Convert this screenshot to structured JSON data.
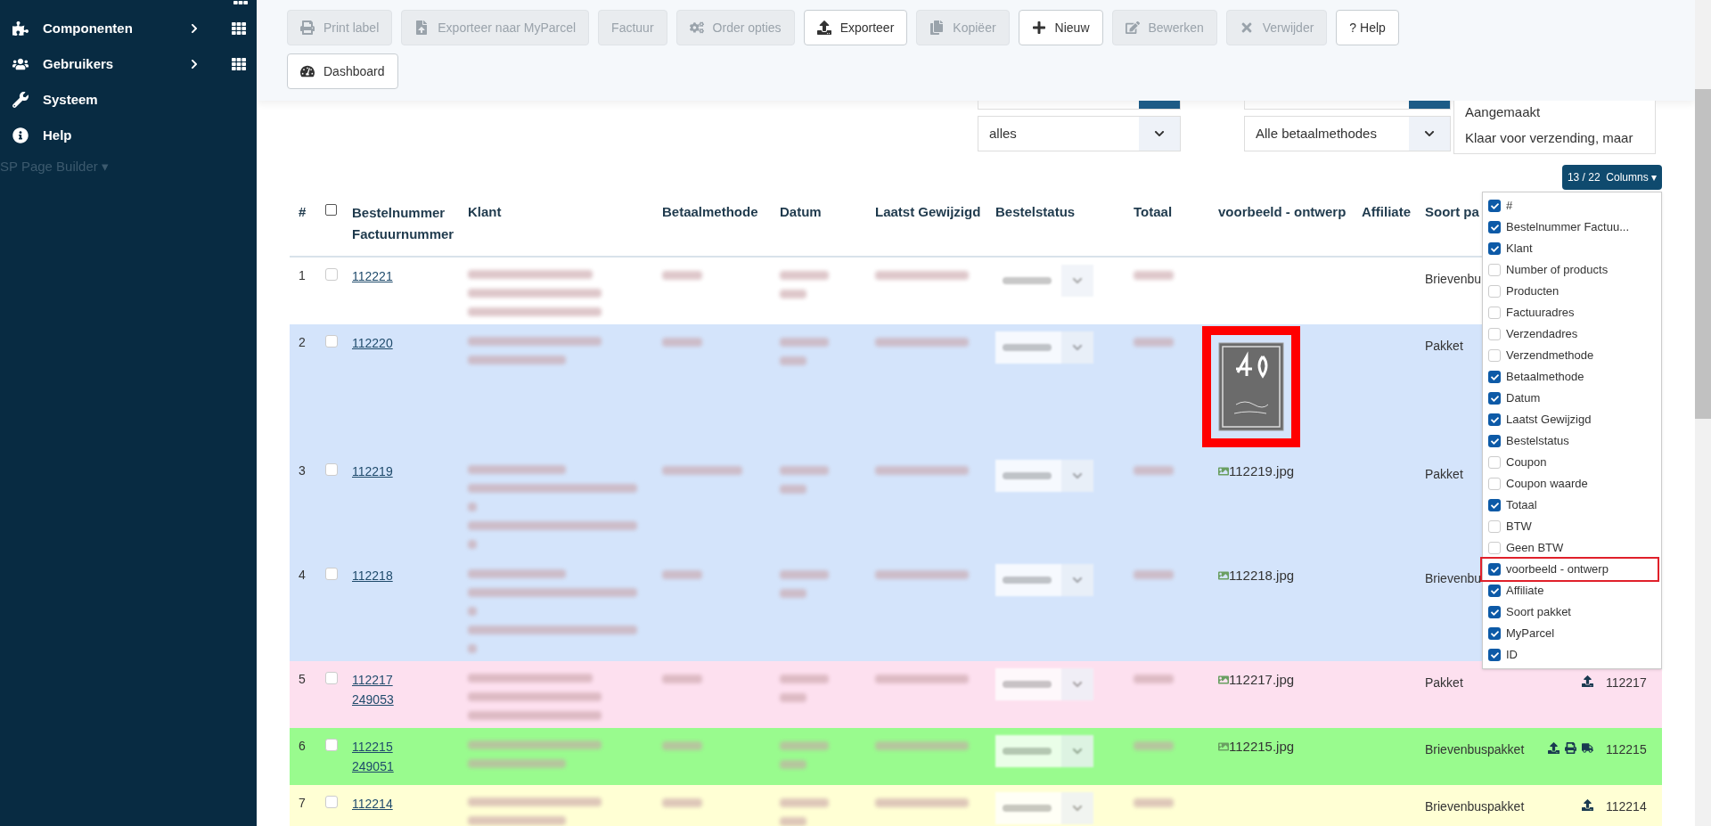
{
  "sidebar": {
    "items": [
      {
        "label": "Componenten",
        "has_submenu": true
      },
      {
        "label": "Gebruikers",
        "has_submenu": true
      },
      {
        "label": "Systeem",
        "has_submenu": false
      },
      {
        "label": "Help",
        "has_submenu": false
      }
    ],
    "faded_item": "SP Page Builder ▾"
  },
  "toolbar": {
    "rows": [
      [
        {
          "label": "Print label",
          "disabled": true
        },
        {
          "label": "Exporteer naar MyParcel",
          "disabled": true
        },
        {
          "label": "Factuur",
          "disabled": true
        },
        {
          "label": "Order opties",
          "disabled": true
        },
        {
          "label": "Exporteer",
          "disabled": false
        },
        {
          "label": "Kopiëer",
          "disabled": true
        },
        {
          "label": "Nieuw",
          "disabled": false
        },
        {
          "label": "Bewerken",
          "disabled": true
        },
        {
          "label": "Verwijder",
          "disabled": true
        },
        {
          "label": "? Help",
          "disabled": false
        }
      ],
      [
        {
          "label": "Dashboard",
          "disabled": false
        }
      ]
    ]
  },
  "filters": {
    "select_1": "alles",
    "select_2": "Alle betaalmethodes",
    "status_options": [
      "Aangemaakt",
      "Klaar voor verzending, maar"
    ]
  },
  "columns_button": "13 / 22  Columns ▾",
  "table": {
    "select_all_checked": false,
    "columns": [
      "#",
      "Bestelnummer",
      "Factuurnummer",
      "Klant",
      "Betaalmethode",
      "Datum",
      "Laatst Gewijzigd",
      "Bestelstatus",
      "Totaal",
      "voorbeeld - ontwerp",
      "Affiliate",
      "Soort pa"
    ],
    "rows": [
      {
        "num": "1",
        "checked": false,
        "order": "112221",
        "color": "#ffffff",
        "kind": "medium",
        "preview": {
          "kind": "none"
        },
        "package": "Brievenbu",
        "actions": []
      },
      {
        "num": "2",
        "checked": false,
        "order": "112220",
        "color": "#d4e4fb",
        "kind": "short",
        "preview": {
          "kind": "plaque"
        },
        "package": "Pakket",
        "actions": []
      },
      {
        "num": "3",
        "checked": false,
        "order": "112219",
        "color": "#d4e4fb",
        "kind": "long",
        "preview": {
          "kind": "broken",
          "alt": "112219.jpg"
        },
        "package": "Pakket",
        "actions": []
      },
      {
        "num": "4",
        "checked": false,
        "order": "112218",
        "color": "#d4e4fb",
        "kind": "long",
        "preview": {
          "kind": "broken",
          "alt": "112218.jpg"
        },
        "package": "Brievenbu",
        "actions": []
      },
      {
        "num": "5",
        "checked": false,
        "order": "112217",
        "invoice": "249053",
        "color": "#fde0ef",
        "kind": "medium",
        "preview": {
          "kind": "broken",
          "alt": "112217.jpg"
        },
        "package": "Pakket",
        "actions": [
          {
            "kind": "export"
          }
        ],
        "id": "112217"
      },
      {
        "num": "6",
        "checked": false,
        "order": "112215",
        "invoice": "249051",
        "color": "#99fb8e",
        "kind": "short",
        "preview": {
          "kind": "broken",
          "alt": "112215.jpg"
        },
        "package": "Brievenbuspakket",
        "actions": [
          {
            "kind": "export"
          },
          {
            "kind": "print"
          },
          {
            "kind": "truck"
          }
        ],
        "id": "112215"
      },
      {
        "num": "7",
        "checked": false,
        "order": "112214",
        "color": "#ffffd4",
        "kind": "short",
        "preview": {
          "kind": "none"
        },
        "package": "Brievenbuspakket",
        "actions": [
          {
            "kind": "export"
          }
        ],
        "id": "112214"
      }
    ]
  },
  "column_menu": [
    {
      "label": "#",
      "checked": true,
      "highlighted": false
    },
    {
      "label": "Bestelnummer Factuu...",
      "checked": true,
      "highlighted": false
    },
    {
      "label": "Klant",
      "checked": true,
      "highlighted": false
    },
    {
      "label": "Number of products",
      "checked": false,
      "highlighted": false
    },
    {
      "label": "Producten",
      "checked": false,
      "highlighted": false
    },
    {
      "label": "Factuuradres",
      "checked": false,
      "highlighted": false
    },
    {
      "label": "Verzendadres",
      "checked": false,
      "highlighted": false
    },
    {
      "label": "Verzendmethode",
      "checked": false,
      "highlighted": false
    },
    {
      "label": "Betaalmethode",
      "checked": true,
      "highlighted": false
    },
    {
      "label": "Datum",
      "checked": true,
      "highlighted": false
    },
    {
      "label": "Laatst Gewijzigd",
      "checked": true,
      "highlighted": false
    },
    {
      "label": "Bestelstatus",
      "checked": true,
      "highlighted": false
    },
    {
      "label": "Coupon",
      "checked": false,
      "highlighted": false
    },
    {
      "label": "Coupon waarde",
      "checked": false,
      "highlighted": false
    },
    {
      "label": "Totaal",
      "checked": true,
      "highlighted": false
    },
    {
      "label": "BTW",
      "checked": false,
      "highlighted": false
    },
    {
      "label": "Geen BTW",
      "checked": false,
      "highlighted": false
    },
    {
      "label": "voorbeeld - ontwerp",
      "checked": true,
      "highlighted": true
    },
    {
      "label": "Affiliate",
      "checked": true,
      "highlighted": false
    },
    {
      "label": "Soort pakket",
      "checked": true,
      "highlighted": false
    },
    {
      "label": "MyParcel",
      "checked": true,
      "highlighted": false
    },
    {
      "label": "ID",
      "checked": true,
      "highlighted": false
    }
  ]
}
